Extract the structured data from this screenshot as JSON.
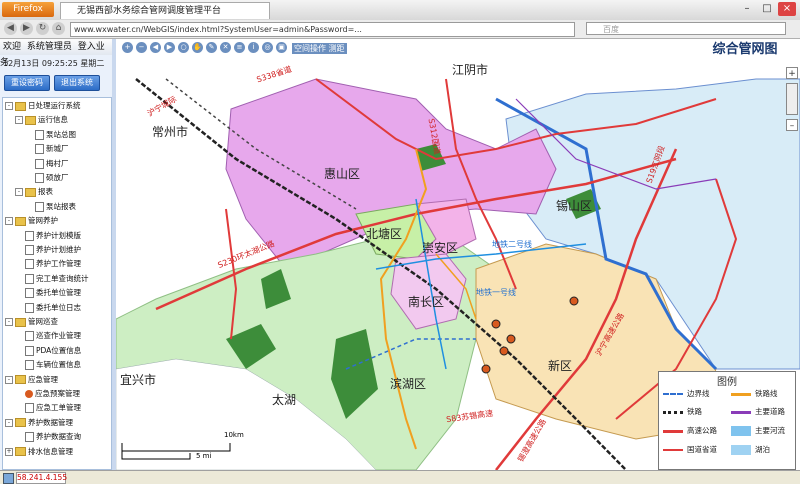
{
  "browser": {
    "menu_label": "Firefox",
    "tab_title": "无锡西部水务综合管网调度管理平台",
    "url": "www.wxwater.cn/WebGIS/index.html?SystemUser=admin&Password=...",
    "search_placeholder": "百度",
    "window_buttons": [
      "–",
      "□",
      "×"
    ]
  },
  "left_panel": {
    "top_menu": [
      "欢迎",
      "系统管理员",
      "登入业务"
    ],
    "datetime": "12月13日 09:25:25",
    "status_text": "星期二",
    "buttons": [
      "重设密码",
      "退出系统"
    ],
    "tree": [
      {
        "label": "日处理运行系统",
        "level": 0,
        "icon": "folder",
        "toggle": "-"
      },
      {
        "label": "运行信息",
        "level": 1,
        "icon": "folder",
        "toggle": "-"
      },
      {
        "label": "泵站总图",
        "level": 2,
        "icon": "doc"
      },
      {
        "label": "新城厂",
        "level": 2,
        "icon": "doc"
      },
      {
        "label": "梅村厂",
        "level": 2,
        "icon": "doc"
      },
      {
        "label": "硕放厂",
        "level": 2,
        "icon": "doc"
      },
      {
        "label": "报表",
        "level": 1,
        "icon": "folder",
        "toggle": "-"
      },
      {
        "label": "泵站报表",
        "level": 2,
        "icon": "doc"
      },
      {
        "label": "管网养护",
        "level": 0,
        "icon": "folder",
        "toggle": "-"
      },
      {
        "label": "养护计划模版",
        "level": 1,
        "icon": "doc"
      },
      {
        "label": "养护计划维护",
        "level": 1,
        "icon": "doc"
      },
      {
        "label": "养护工作管理",
        "level": 1,
        "icon": "doc"
      },
      {
        "label": "完工单查询统计",
        "level": 1,
        "icon": "doc"
      },
      {
        "label": "委托单位管理",
        "level": 1,
        "icon": "doc"
      },
      {
        "label": "委托单位日志",
        "level": 1,
        "icon": "doc"
      },
      {
        "label": "管网巡查",
        "level": 0,
        "icon": "folder",
        "toggle": "-"
      },
      {
        "label": "巡查作业管理",
        "level": 1,
        "icon": "doc"
      },
      {
        "label": "PDA位置信息",
        "level": 1,
        "icon": "doc"
      },
      {
        "label": "车辆位置信息",
        "level": 1,
        "icon": "doc"
      },
      {
        "label": "应急管理",
        "level": 0,
        "icon": "folder",
        "toggle": "-"
      },
      {
        "label": "应急预案管理",
        "level": 1,
        "icon": "circle"
      },
      {
        "label": "应急工单管理",
        "level": 1,
        "icon": "doc"
      },
      {
        "label": "养护数据管理",
        "level": 0,
        "icon": "folder",
        "toggle": "-"
      },
      {
        "label": "养护数据查询",
        "level": 1,
        "icon": "doc"
      },
      {
        "label": "排水信息管理",
        "level": 0,
        "icon": "folder",
        "toggle": "+"
      }
    ]
  },
  "map": {
    "title": "综合管网图",
    "toolbar_label": "空间操作 测距",
    "places": {
      "jiangyin": "江阴市",
      "changzhou": "常州市",
      "huishan": "惠山区",
      "xishan": "锡山区",
      "beitang": "北塘区",
      "chongan": "崇安区",
      "nanchang": "南长区",
      "binhu": "滨湖区",
      "xinqu": "新区",
      "yixing": "宜兴市",
      "taihu": "太湖"
    },
    "road_labels": {
      "s338": "S338省道",
      "hucheng": "沪宁城际",
      "s230": "S230环太湖公路",
      "s19": "S19江阴段",
      "s312": "S312国道",
      "hu_ning": "沪宁高速公路",
      "s83": "S83苏锡高速",
      "xinan": "锡澄高速公路",
      "line2": "地铁二号线",
      "line1": "地铁一号线"
    },
    "scale_labels": [
      "10km",
      "5 mi"
    ],
    "legend": {
      "title": "图例",
      "items": [
        "边界线",
        "铁路线",
        "铁路",
        "主要道路",
        "高速公路",
        "主要河流",
        "国道省道",
        "湖泊"
      ]
    },
    "zoom": [
      "+",
      "–"
    ]
  },
  "statusbar": {
    "ip": "58.241.4.155"
  },
  "colors": {
    "huishan": "#e7a8ec",
    "xishan": "#d8ecf7",
    "binhu": "#cdeec3",
    "xinqu": "#f9e3b5",
    "beitang": "#c7f0a7",
    "chongan": "#f3b3e9",
    "highway": "#e03a3a",
    "green": "#3d8d3a",
    "boundary": "#2f6fd0"
  }
}
